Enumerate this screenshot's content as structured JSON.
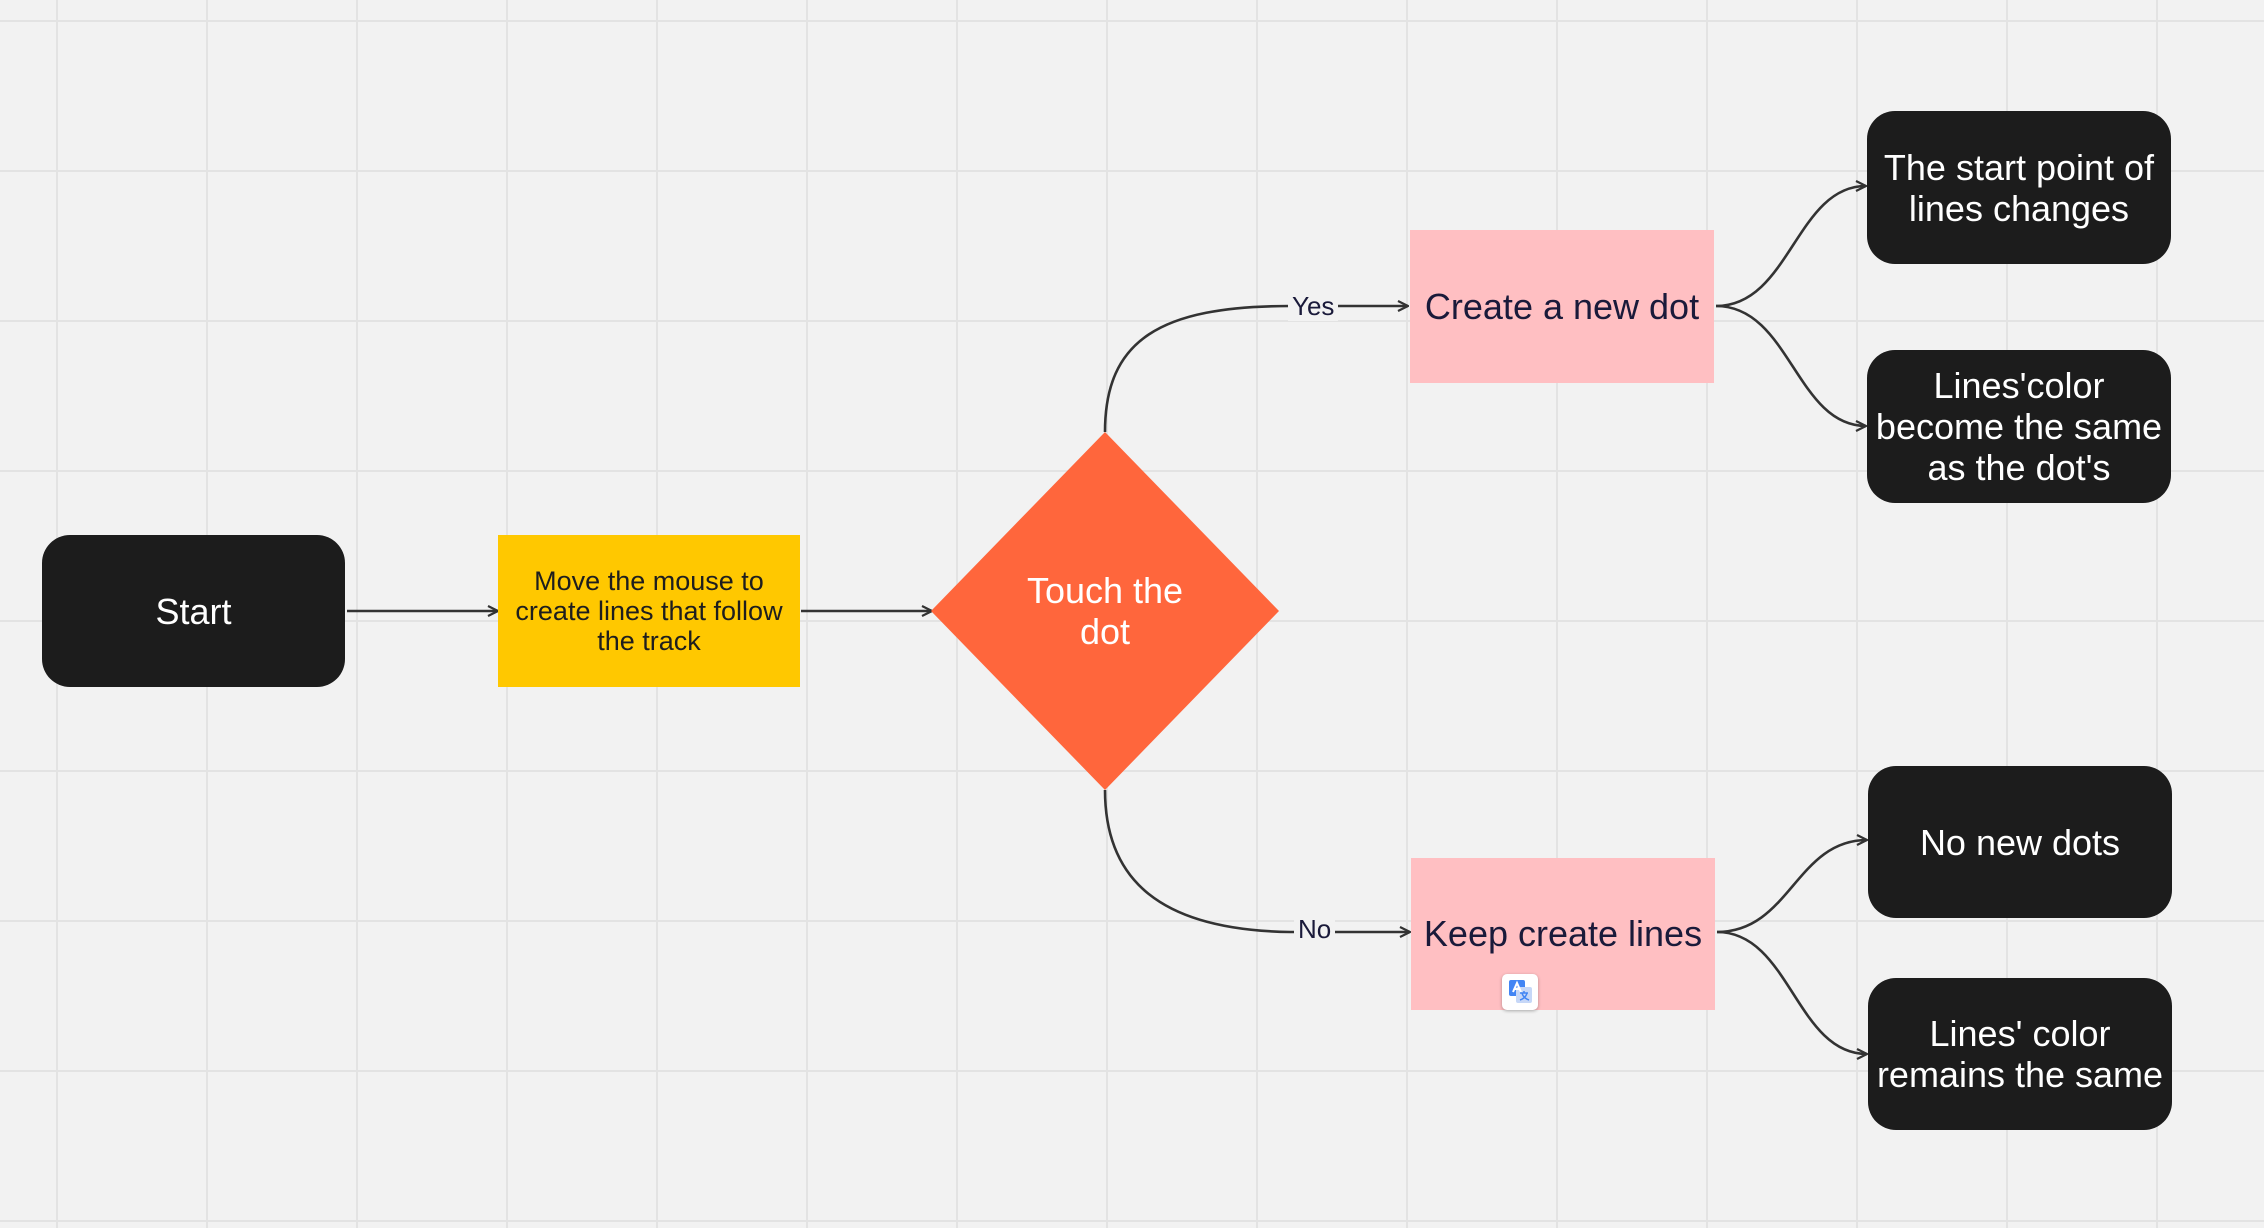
{
  "nodes": {
    "start": "Start",
    "move": "Move the mouse to\ncreate lines that follow\nthe track",
    "decision": "Touch the\ndot",
    "create_dot": "Create a new dot",
    "keep_lines": "Keep create lines",
    "start_point": "The start point of\nlines changes",
    "color_same_dot": "Lines'color\nbecome the same\nas the dot's",
    "no_new_dots": "No new dots",
    "color_remains": "Lines' color\nremains the same"
  },
  "edges": {
    "yes_label": "Yes",
    "no_label": "No"
  },
  "colors": {
    "terminal": "#1c1c1c",
    "process": "#ffc800",
    "decision": "#ff663c",
    "outcome": "#ffbfc2",
    "connector": "#333333",
    "canvas": "#f2f2f2"
  },
  "icons": {
    "translate": "google-translate-icon"
  }
}
